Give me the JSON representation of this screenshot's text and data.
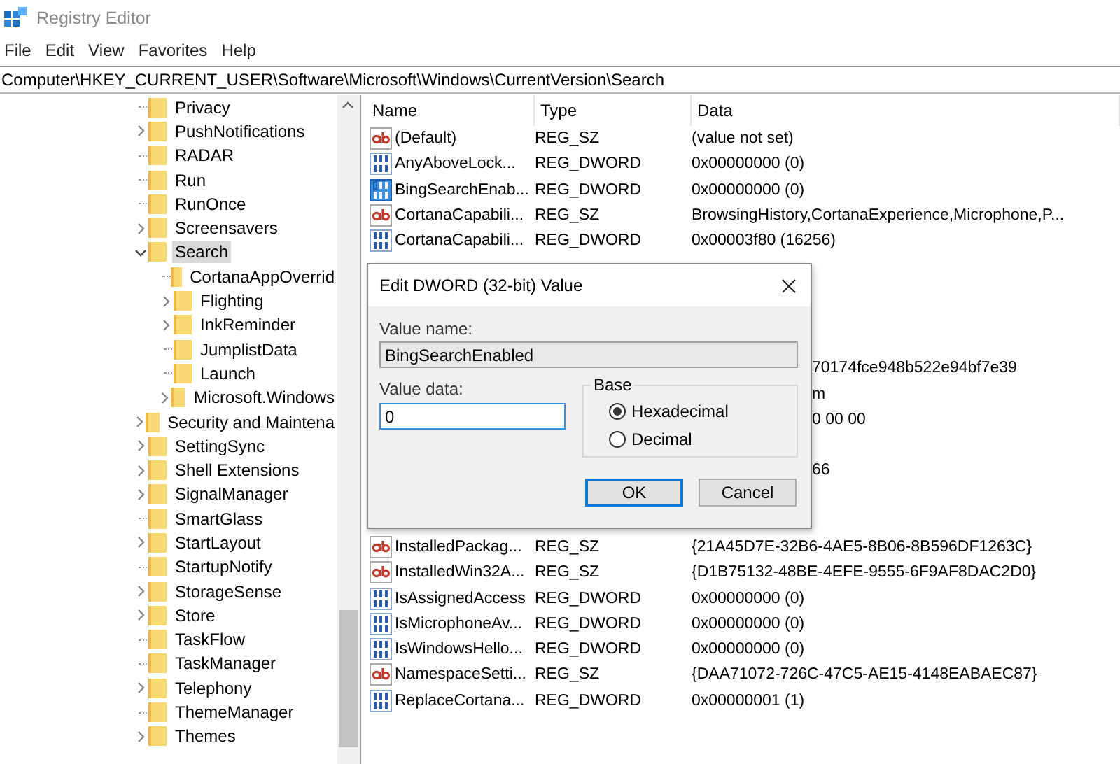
{
  "window": {
    "title": "Registry Editor"
  },
  "menu": [
    "File",
    "Edit",
    "View",
    "Favorites",
    "Help"
  ],
  "address": "Computer\\HKEY_CURRENT_USER\\Software\\Microsoft\\Windows\\CurrentVersion\\Search",
  "tree": [
    {
      "label": "Privacy",
      "expandable": false,
      "selected": false
    },
    {
      "label": "PushNotifications",
      "expandable": true,
      "selected": false
    },
    {
      "label": "RADAR",
      "expandable": false,
      "selected": false
    },
    {
      "label": "Run",
      "expandable": false,
      "selected": false
    },
    {
      "label": "RunOnce",
      "expandable": false,
      "selected": false
    },
    {
      "label": "Screensavers",
      "expandable": true,
      "selected": false
    },
    {
      "label": "Search",
      "expandable": true,
      "selected": true,
      "children": [
        {
          "label": "CortanaAppOverrid",
          "expandable": false,
          "selected": false
        },
        {
          "label": "Flighting",
          "expandable": true,
          "selected": false
        },
        {
          "label": "InkReminder",
          "expandable": true,
          "selected": false
        },
        {
          "label": "JumplistData",
          "expandable": false,
          "selected": false
        },
        {
          "label": "Launch",
          "expandable": false,
          "selected": false
        },
        {
          "label": "Microsoft.Windows",
          "expandable": true,
          "selected": false
        }
      ]
    },
    {
      "label": "Security and Maintena",
      "expandable": true,
      "selected": false
    },
    {
      "label": "SettingSync",
      "expandable": true,
      "selected": false
    },
    {
      "label": "Shell Extensions",
      "expandable": true,
      "selected": false
    },
    {
      "label": "SignalManager",
      "expandable": true,
      "selected": false
    },
    {
      "label": "SmartGlass",
      "expandable": false,
      "selected": false
    },
    {
      "label": "StartLayout",
      "expandable": true,
      "selected": false
    },
    {
      "label": "StartupNotify",
      "expandable": false,
      "selected": false
    },
    {
      "label": "StorageSense",
      "expandable": true,
      "selected": false
    },
    {
      "label": "Store",
      "expandable": true,
      "selected": false
    },
    {
      "label": "TaskFlow",
      "expandable": false,
      "selected": false
    },
    {
      "label": "TaskManager",
      "expandable": false,
      "selected": false
    },
    {
      "label": "Telephony",
      "expandable": true,
      "selected": false
    },
    {
      "label": "ThemeManager",
      "expandable": false,
      "selected": false
    },
    {
      "label": "Themes",
      "expandable": true,
      "selected": false
    }
  ],
  "values": {
    "columns": [
      "Name",
      "Type",
      "Data"
    ],
    "rows": [
      {
        "kind": "string",
        "name": "(Default)",
        "type": "REG_SZ",
        "data": "(value not set)",
        "selected": false
      },
      {
        "kind": "dword",
        "name": "AnyAboveLock...",
        "type": "REG_DWORD",
        "data": "0x00000000 (0)",
        "selected": false
      },
      {
        "kind": "dword",
        "name": "BingSearchEnab...",
        "type": "REG_DWORD",
        "data": "0x00000000 (0)",
        "selected": true
      },
      {
        "kind": "string",
        "name": "CortanaCapabili...",
        "type": "REG_SZ",
        "data": "BrowsingHistory,CortanaExperience,Microphone,P...",
        "selected": false
      },
      {
        "kind": "dword",
        "name": "CortanaCapabili...",
        "type": "REG_DWORD",
        "data": "0x00003f80 (16256)",
        "selected": false
      },
      {
        "kind": "covered"
      },
      {
        "kind": "covered"
      },
      {
        "kind": "covered"
      },
      {
        "kind": "covered"
      },
      {
        "kind": "partial",
        "data": "70174fce948b522e94bf7e39"
      },
      {
        "kind": "partial",
        "data": "m"
      },
      {
        "kind": "partial",
        "data": "0 00 00"
      },
      {
        "kind": "covered"
      },
      {
        "kind": "partial",
        "data": "66"
      },
      {
        "kind": "covered"
      },
      {
        "kind": "covered"
      },
      {
        "kind": "string",
        "name": "InstalledPackag...",
        "type": "REG_SZ",
        "data": "{21A45D7E-32B6-4AE5-8B06-8B596DF1263C}",
        "selected": false
      },
      {
        "kind": "string",
        "name": "InstalledWin32A...",
        "type": "REG_SZ",
        "data": "{D1B75132-48BE-4EFE-9555-6F9AF8DAC2D0}",
        "selected": false
      },
      {
        "kind": "dword",
        "name": "IsAssignedAccess",
        "type": "REG_DWORD",
        "data": "0x00000000 (0)",
        "selected": false
      },
      {
        "kind": "dword",
        "name": "IsMicrophoneAv...",
        "type": "REG_DWORD",
        "data": "0x00000000 (0)",
        "selected": false
      },
      {
        "kind": "dword",
        "name": "IsWindowsHello...",
        "type": "REG_DWORD",
        "data": "0x00000000 (0)",
        "selected": false
      },
      {
        "kind": "string",
        "name": "NamespaceSetti...",
        "type": "REG_SZ",
        "data": "{DAA71072-726C-47C5-AE15-4148EABAEC87}",
        "selected": false
      },
      {
        "kind": "dword",
        "name": "ReplaceCortana...",
        "type": "REG_DWORD",
        "data": "0x00000001 (1)",
        "selected": false
      }
    ]
  },
  "dialog": {
    "title": "Edit DWORD (32-bit) Value",
    "value_name_label": "Value name:",
    "value_name": "BingSearchEnabled",
    "value_data_label": "Value data:",
    "value_data": "0",
    "base_label": "Base",
    "radios": [
      {
        "label": "Hexadecimal",
        "selected": true
      },
      {
        "label": "Decimal",
        "selected": false
      }
    ],
    "buttons": [
      {
        "label": "OK",
        "default": true
      },
      {
        "label": "Cancel",
        "default": false
      }
    ]
  }
}
